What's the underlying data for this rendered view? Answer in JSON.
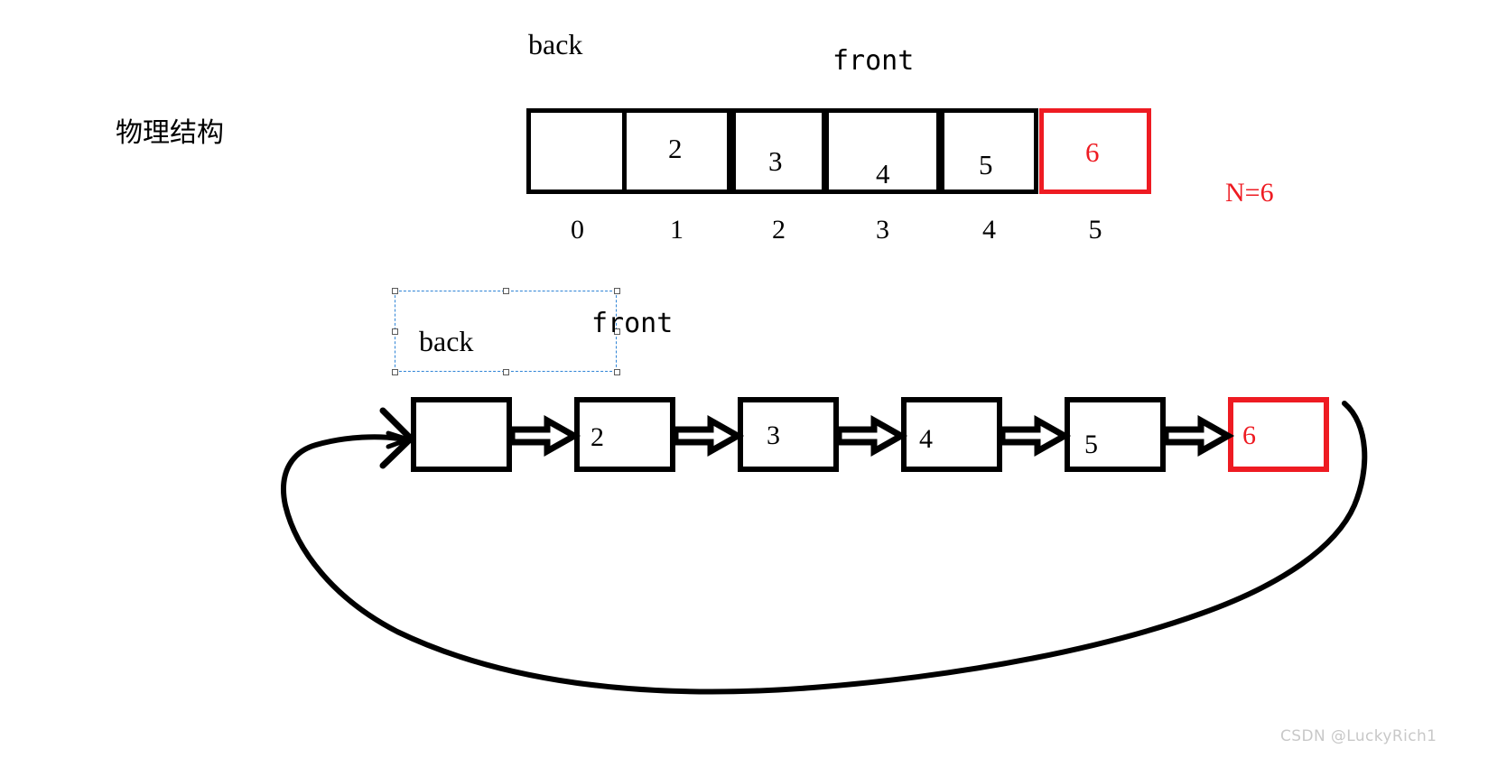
{
  "diagram": {
    "title_cn": "物理结构",
    "capacity_note": "N=6",
    "watermark": "CSDN @LuckyRich1",
    "accent_red": "#ee1b22",
    "stroke_black": "#000000",
    "selection_blue": "#2f84d6"
  },
  "array_section": {
    "pointer_back_label": "back",
    "pointer_front_label": "front",
    "cells": [
      {
        "value": "",
        "index": "0",
        "highlight": false
      },
      {
        "value": "2",
        "index": "1",
        "highlight": false
      },
      {
        "value": "3",
        "index": "2",
        "highlight": false
      },
      {
        "value": "4",
        "index": "3",
        "highlight": false
      },
      {
        "value": "5",
        "index": "4",
        "highlight": false
      },
      {
        "value": "6",
        "index": "5",
        "highlight": true
      }
    ]
  },
  "list_section": {
    "pointer_back_label": "back",
    "pointer_front_label": "front",
    "nodes": [
      {
        "value": "",
        "highlight": false
      },
      {
        "value": "2",
        "highlight": false
      },
      {
        "value": "3",
        "highlight": false
      },
      {
        "value": "4",
        "highlight": false
      },
      {
        "value": "5",
        "highlight": false
      },
      {
        "value": "6",
        "highlight": true
      }
    ]
  }
}
